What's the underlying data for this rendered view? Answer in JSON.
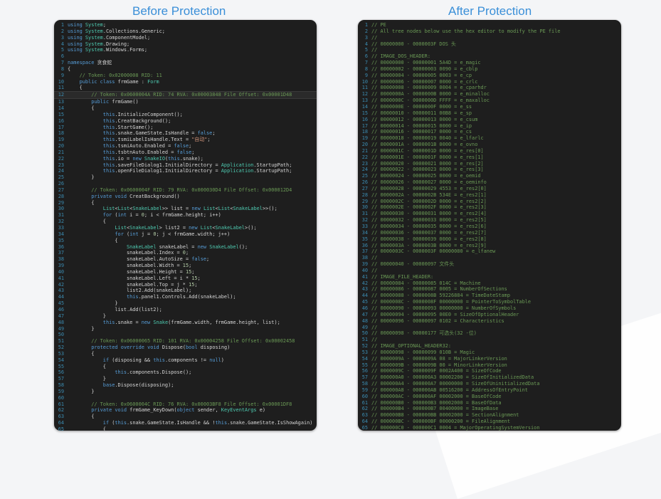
{
  "captions": {
    "before": "Before Protection",
    "after": "After Protection"
  },
  "before_lines": [
    "using System;",
    "using System.Collections.Generic;",
    "using System.ComponentModel;",
    "using System.Drawing;",
    "using System.Windows.Forms;",
    "",
    "namespace 贪食蛇",
    "{",
    "    // Token: 0x02000008 RID: 11",
    "    public class frmGame : Form",
    "    {",
    "        // Token: 0x0600004A RID: 74 RVA: 0x00003848 File Offset: 0x00001D48",
    "        public frmGame()",
    "        {",
    "            this.InitializeComponent();",
    "            this.CreatBackground();",
    "            this.StartGame();",
    "            this.snake.GameState.IsHandle = false;",
    "            this.tsmiLabelIsHandle.Text = \"自动\";",
    "            this.tsmiAuto.Enabled = false;",
    "            this.tsbtnAuto.Enabled = false;",
    "            this.io = new SnakeIO(this.snake);",
    "            this.saveFileDialog1.InitialDirectory = Application.StartupPath;",
    "            this.openFileDialog1.InitialDirectory = Application.StartupPath;",
    "        }",
    "",
    "        // Token: 0x0600004F RID: 79 RVA: 0x000030D4 File Offset: 0x000012D4",
    "        private void CreatBackground()",
    "        {",
    "            List<List<SnakeLabel>> list = new List<List<SnakeLabel>>();",
    "            for (int i = 0; i < frmGame.height; i++)",
    "            {",
    "                List<SnakeLabel> list2 = new List<SnakeLabel>();",
    "                for (int j = 0; j < frmGame.width; j++)",
    "                {",
    "                    SnakeLabel snakeLabel = new SnakeLabel();",
    "                    snakeLabel.Index = 0;",
    "                    snakeLabel.AutoSize = false;",
    "                    snakeLabel.Width = 15;",
    "                    snakeLabel.Height = 15;",
    "                    snakeLabel.Left = i * 15;",
    "                    snakeLabel.Top = j * 15;",
    "                    list2.Add(snakeLabel);",
    "                    this.panel1.Controls.Add(snakeLabel);",
    "                }",
    "                list.Add(list2);",
    "            }",
    "            this.snake = new Snake(frmGame.width, frmGame.height, list);",
    "        }",
    "",
    "        // Token: 0x06000065 RID: 101 RVA: 0x00004258 File Offset: 0x00002458",
    "        protected override void Dispose(bool disposing)",
    "        {",
    "            if (disposing && this.components != null)",
    "            {",
    "                this.components.Dispose();",
    "            }",
    "            base.Dispose(disposing);",
    "        }",
    "",
    "        // Token: 0x0600004C RID: 76 RVA: 0x00003BF8 File Offset: 0x00001DF8",
    "        private void frmGame_KeyDown(object sender, KeyEventArgs e)",
    "        {",
    "            if (this.snake.GameState.IsHandle && !this.snake.GameState.IsShowAgain)",
    "            {"
  ],
  "after_lines": [
    "// PE",
    "// All tree nodes below use the hex editor to modify the PE file",
    "//",
    "// 00000000 - 0000003F DOS 头",
    "//",
    "// IMAGE_DOS_HEADER:",
    "// 00000000 - 00000001 5A4D = e_magic",
    "// 00000002 - 00000003 0090 = e_cblp",
    "// 00000004 - 00000005 0003 = e_cp",
    "// 00000006 - 00000007 0000 = e_crlc",
    "// 00000008 - 00000009 0004 = e_cparhdr",
    "// 0000000A - 0000000B 0000 = e_minalloc",
    "// 0000000C - 0000000D FFFF = e_maxalloc",
    "// 0000000E - 0000000F 0000 = e_ss",
    "// 00000010 - 00000011 00B8 = e_sp",
    "// 00000012 - 00000013 0000 = e_csum",
    "// 00000014 - 00000015 0000 = e_ip",
    "// 00000016 - 00000017 0000 = e_cs",
    "// 00000018 - 00000019 0040 = e_lfarlc",
    "// 0000001A - 0000001B 0000 = e_ovno",
    "// 0000001C - 0000001D 0000 = e_res[0]",
    "// 0000001E - 0000001F 0000 = e_res[1]",
    "// 00000020 - 00000021 0000 = e_res[2]",
    "// 00000022 - 00000023 0000 = e_res[3]",
    "// 00000024 - 00000025 0000 = e_oemid",
    "// 00000026 - 00000027 0000 = e_oeminfo",
    "// 00000028 - 00000029 4553 = e_res2[0]",
    "// 0000002A - 0000002B 534E = e_res2[1]",
    "// 0000002C - 0000002D 0000 = e_res2[2]",
    "// 0000002E - 0000002F 0000 = e_res2[3]",
    "// 00000030 - 00000031 0000 = e_res2[4]",
    "// 00000032 - 00000033 0000 = e_res2[5]",
    "// 00000034 - 00000035 0000 = e_res2[6]",
    "// 00000036 - 00000037 0000 = e_res2[7]",
    "// 00000038 - 00000039 0000 = e_res2[8]",
    "// 0000003A - 0000003B 0000 = e_res2[9]",
    "// 0000003C - 0000003F 00000080 = e_lfanew",
    "//",
    "// 00000040 - 00000097 文件头",
    "//",
    "// IMAGE_FILE_HEADER:",
    "// 00000084 - 00000085 014C = Machine",
    "// 00000086 - 00000087 0005 = NumberOfSections",
    "// 00000088 - 0000008B 59226884 = TimeDateStamp",
    "// 0000008C - 0000008F 00000000 = PointerToSymbolTable",
    "// 00000090 - 00000093 00000000 = NumberOfSymbols",
    "// 00000094 - 00000095 00E0 = SizeOfOptionalHeader",
    "// 00000096 - 00000097 0102 = Characteristics",
    "//",
    "// 00000098 - 00000177 可选头(32 -位)",
    "//",
    "// IMAGE_OPTIONAL_HEADER32:",
    "// 00000098 - 00000099 010B = Magic",
    "// 0000009A - 0000009A 08 = MajorLinkerVersion",
    "// 0000009B - 0000009B 00 = MinorLinkerVersion",
    "// 0000009C - 0000009F 0002A400 = SizeOfCode",
    "// 000000A0 - 000000A3 00002200 = SizeOfInitializedData",
    "// 000000A4 - 000000A7 00000000 = SizeOfUninitializedData",
    "// 000000A8 - 000000AB 00516200 = AddressOfEntryPoint",
    "// 000000AC - 000000AF 00002000 = BaseOfCode",
    "// 000000B0 - 000000B3 00002000 = BaseOfData",
    "// 000000B4 - 000000B7 00400000 = ImageBase",
    "// 000000B8 - 000000BB 00002000 = SectionAlignment",
    "// 000000BC - 000000BF 00000200 = FileAlignment",
    "// 000000C0 - 000000C1 0004 = MajorOperatingSystemVersion"
  ]
}
